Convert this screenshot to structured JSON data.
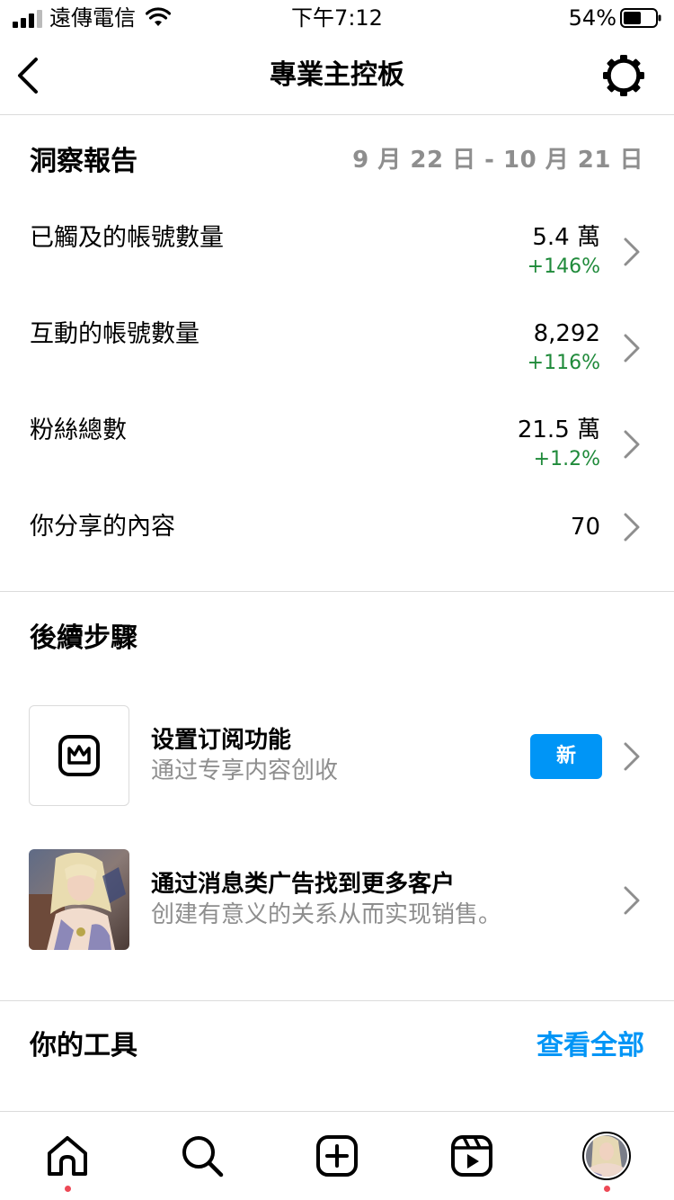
{
  "status_bar": {
    "carrier": "遠傳電信",
    "time": "下午7:12",
    "battery": "54%"
  },
  "nav": {
    "title": "專業主控板",
    "icons": {
      "back": "chevron-left-icon",
      "settings": "gear-icon"
    }
  },
  "insights": {
    "title": "洞察報告",
    "date_range": "9 月 22 日 - 10 月 21 日",
    "metrics": [
      {
        "label": "已觸及的帳號數量",
        "value": "5.4 萬",
        "change": "+146%"
      },
      {
        "label": "互動的帳號數量",
        "value": "8,292",
        "change": "+116%"
      },
      {
        "label": "粉絲總數",
        "value": "21.5 萬",
        "change": "+1.2%"
      },
      {
        "label": "你分享的內容",
        "value": "70"
      }
    ],
    "change_color": "#1f8a3a"
  },
  "next_steps": {
    "title": "後續步驟",
    "items": [
      {
        "title": "设置订阅功能",
        "subtitle": "通过专享内容创收",
        "badge": "新",
        "icon": "crown-icon"
      },
      {
        "title": "通过消息类广告找到更多客户",
        "subtitle": "创建有意义的关系从而实现销售。",
        "icon": "photo-thumbnail"
      }
    ]
  },
  "tools": {
    "title": "你的工具",
    "see_all": "查看全部"
  },
  "tab_bar": {
    "tabs": [
      "home-icon",
      "search-icon",
      "create-icon",
      "reels-icon",
      "profile-avatar"
    ],
    "notification_color": "#ed4956"
  },
  "colors": {
    "accent": "#0095f6",
    "muted": "#8e8e8e",
    "divider": "#dbdbdb"
  }
}
